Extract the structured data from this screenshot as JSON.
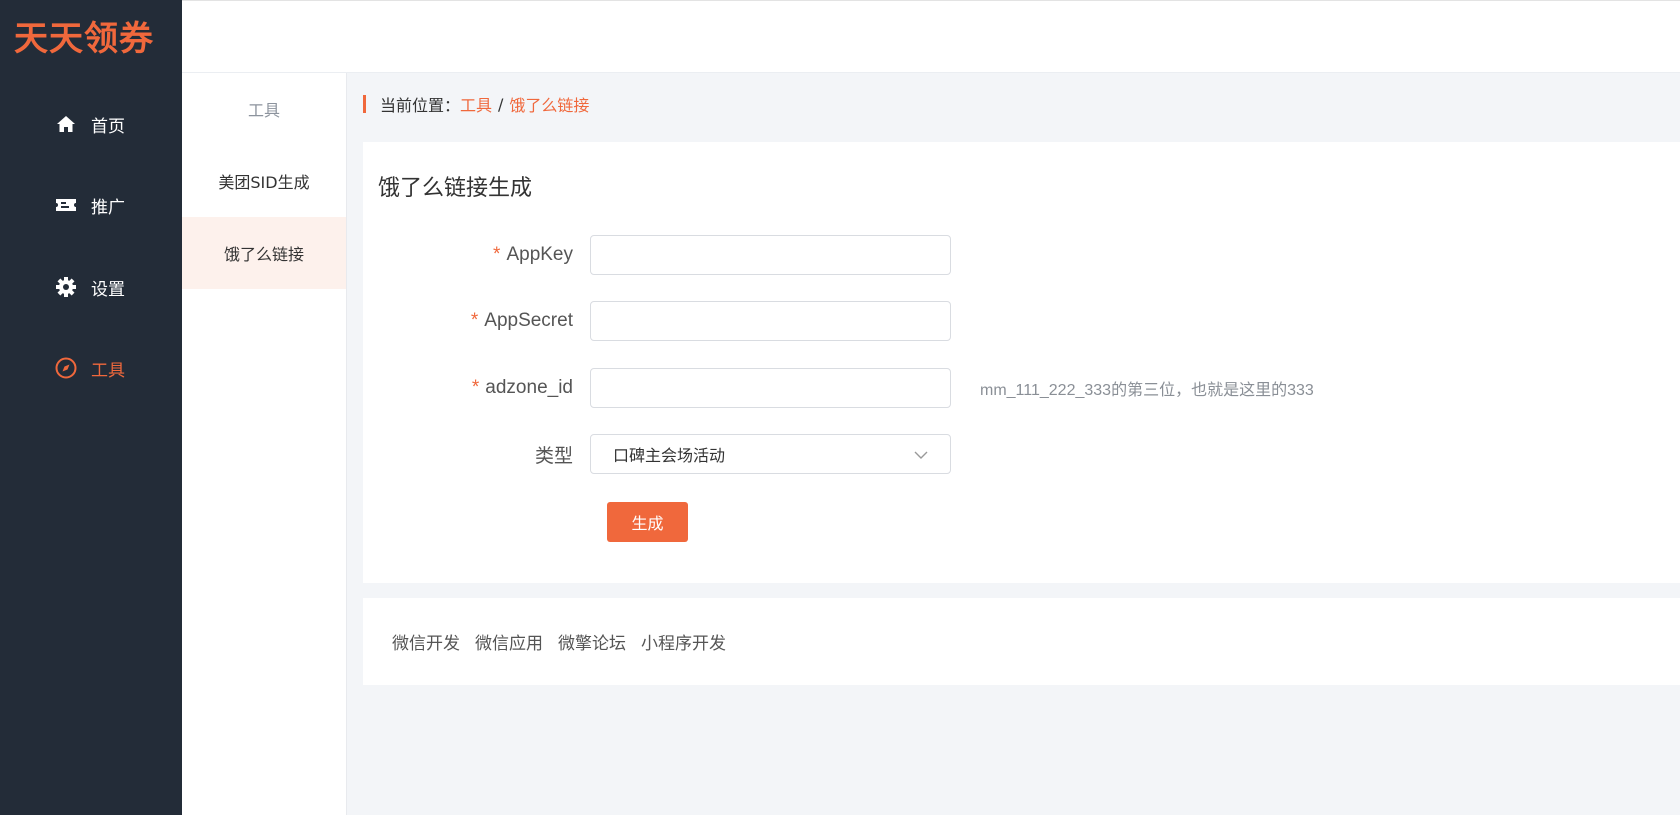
{
  "brand": {
    "logo_text": "天天领券",
    "accent": "#f0683c"
  },
  "sidebar": {
    "items": [
      {
        "label": "首页",
        "icon": "home-icon"
      },
      {
        "label": "推广",
        "icon": "ticket-icon"
      },
      {
        "label": "设置",
        "icon": "gear-icon"
      },
      {
        "label": "工具",
        "icon": "compass-icon",
        "active": true
      }
    ]
  },
  "subnav": {
    "title": "工具",
    "items": [
      {
        "label": "美团SID生成"
      },
      {
        "label": "饿了么链接",
        "active": true
      }
    ]
  },
  "breadcrumb": {
    "prefix": "当前位置：",
    "items": [
      "工具",
      "饿了么链接"
    ],
    "separator": "/"
  },
  "form": {
    "title": "饿了么链接生成",
    "required_mark": "*",
    "fields": [
      {
        "label": "AppKey",
        "required": true,
        "value": "",
        "placeholder": ""
      },
      {
        "label": "AppSecret",
        "required": true,
        "value": "",
        "placeholder": ""
      },
      {
        "label": "adzone_id",
        "required": true,
        "value": "",
        "placeholder": "",
        "hint": "mm_111_222_333的第三位，也就是这里的333"
      }
    ],
    "type_field": {
      "label": "类型",
      "selected": "口碑主会场活动"
    },
    "submit_label": "生成"
  },
  "footer": {
    "links": [
      "微信开发",
      "微信应用",
      "微擎论坛",
      "小程序开发"
    ]
  }
}
